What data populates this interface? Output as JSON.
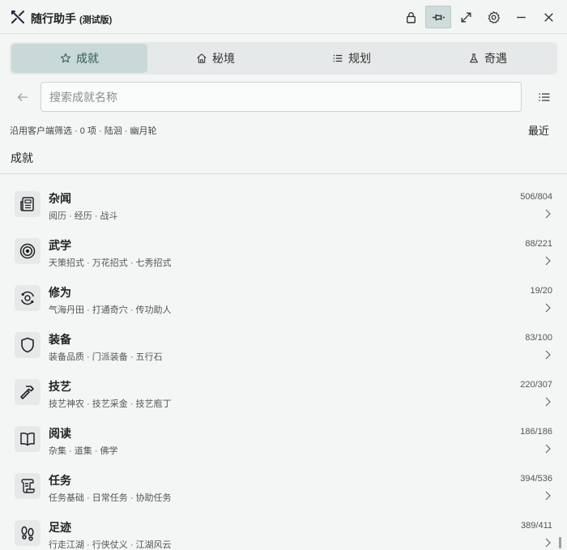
{
  "app": {
    "name": "随行助手",
    "edition": "(测试版)"
  },
  "tabs": [
    {
      "label": "成就",
      "icon": "star-icon",
      "active": true
    },
    {
      "label": "秘境",
      "icon": "home-icon",
      "active": false
    },
    {
      "label": "规划",
      "icon": "list-icon",
      "active": false
    },
    {
      "label": "奇遇",
      "icon": "flask-icon",
      "active": false
    }
  ],
  "search": {
    "placeholder": "搜索成就名称",
    "value": ""
  },
  "filter_info": "沿用客户端筛选 · 0 项 · 陆洄 · 幽月轮",
  "sort_label": "最近",
  "section_title": "成就",
  "items": [
    {
      "title": "杂闻",
      "subtitle": "阅历 · 经历 · 战斗",
      "count": "506/804",
      "icon": "newspaper-icon"
    },
    {
      "title": "武学",
      "subtitle": "天策招式 · 万花招式 · 七秀招式",
      "count": "88/221",
      "icon": "target-icon"
    },
    {
      "title": "修为",
      "subtitle": "气海丹田 · 打通奇穴 · 传功助人",
      "count": "19/20",
      "icon": "orbit-icon"
    },
    {
      "title": "装备",
      "subtitle": "装备品质 · 门派装备 · 五行石",
      "count": "83/100",
      "icon": "shield-icon"
    },
    {
      "title": "技艺",
      "subtitle": "技艺神农 · 技艺采金 · 技艺庖丁",
      "count": "220/307",
      "icon": "hammer-icon"
    },
    {
      "title": "阅读",
      "subtitle": "杂集 · 道集 · 佛学",
      "count": "186/186",
      "icon": "book-icon"
    },
    {
      "title": "任务",
      "subtitle": "任务基础 · 日常任务 · 协助任务",
      "count": "394/536",
      "icon": "scroll-icon"
    },
    {
      "title": "足迹",
      "subtitle": "行走江湖 · 行侠仗义 · 江湖风云",
      "count": "389/411",
      "icon": "footprints-icon"
    }
  ],
  "colors": {
    "accent": "#c9d9d7",
    "accent_text": "#2d5a56",
    "background": "#f4f5f5"
  }
}
